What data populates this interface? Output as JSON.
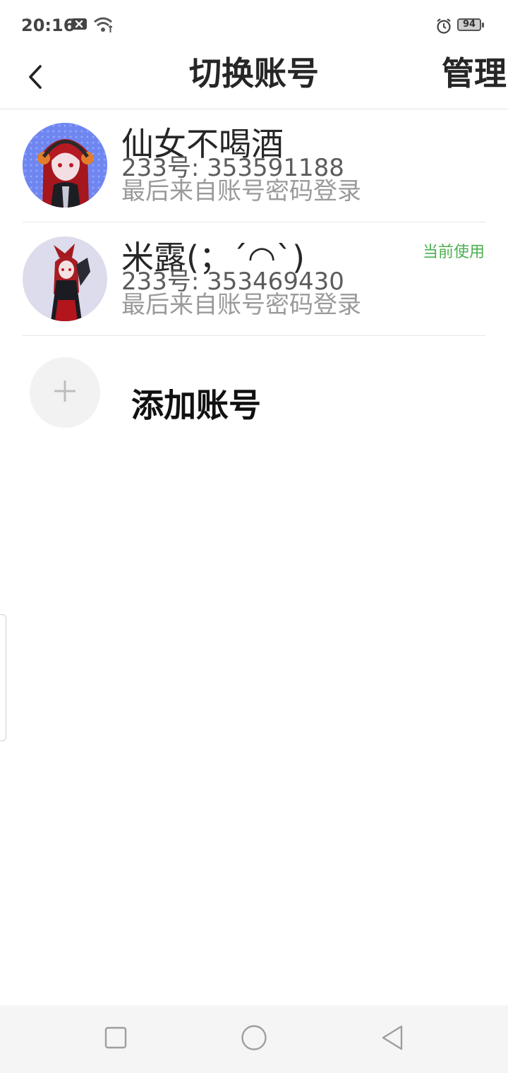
{
  "status_bar": {
    "time": "20:16",
    "battery": "94",
    "icons": [
      "notification-x-icon",
      "wifi-icon",
      "alarm-icon",
      "battery-icon"
    ]
  },
  "header": {
    "title": "切换账号",
    "manage_label": "管理",
    "back_icon": "chevron-left-icon"
  },
  "accounts": [
    {
      "name": "仙女不喝酒",
      "id_text": "233号: 353591188",
      "login_text": "最后来自账号密码登录",
      "current": false
    },
    {
      "name": "米露(；´◠`)",
      "id_text": "233号: 353469430",
      "login_text": "最后来自账号密码登录",
      "current": true,
      "current_label": "当前使用"
    }
  ],
  "add_account": {
    "label": "添加账号",
    "icon": "plus-icon"
  },
  "nav_bar": {
    "buttons": [
      "recents-square-icon",
      "home-circle-icon",
      "back-triangle-icon"
    ]
  },
  "colors": {
    "accent_green": "#4caf50",
    "text_dark": "#262626",
    "text_gray": "#9a9a9a",
    "divider": "#e6e6e6",
    "nav_bg": "#f5f5f5"
  }
}
